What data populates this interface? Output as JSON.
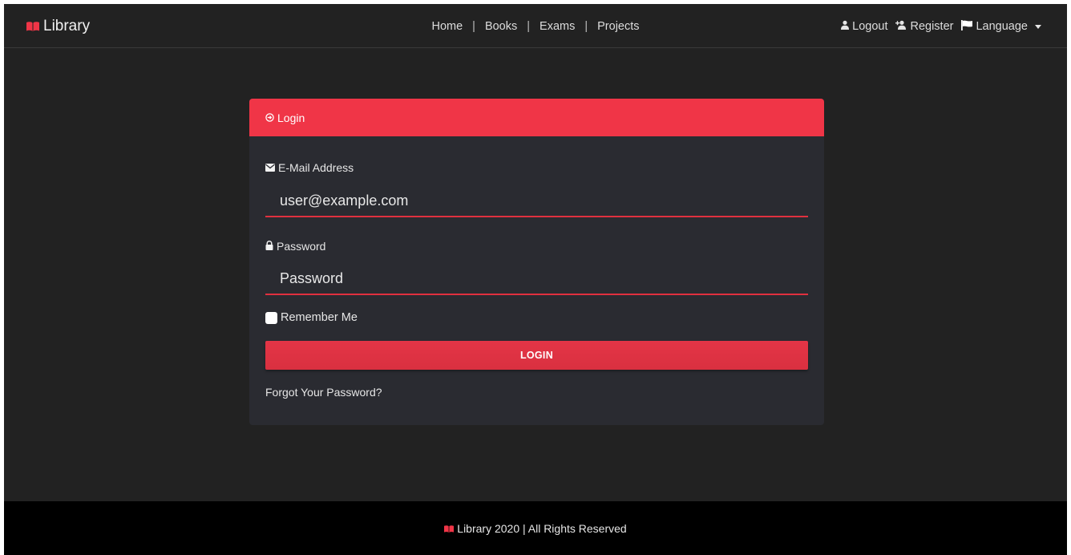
{
  "brand": {
    "name": "Library",
    "icon": "book-open-icon",
    "accent": "#f03547"
  },
  "nav": {
    "links": [
      "Home",
      "Books",
      "Exams",
      "Projects"
    ],
    "separator": "|",
    "logout": "Logout",
    "register": "Register",
    "language": "Language"
  },
  "login_card": {
    "header": "Login",
    "email_label": "E-Mail Address",
    "email_value": "user@example.com",
    "password_label": "Password",
    "password_placeholder": "Password",
    "remember_label": "Remember Me",
    "remember_checked": false,
    "submit_label": "LOGIN",
    "forgot_label": "Forgot Your Password?"
  },
  "footer": {
    "text": "Library 2020 | All Rights Reserved"
  },
  "colors": {
    "background": "#222222",
    "card": "#2a2b31",
    "accent": "#f03547",
    "footer": "#000000"
  }
}
